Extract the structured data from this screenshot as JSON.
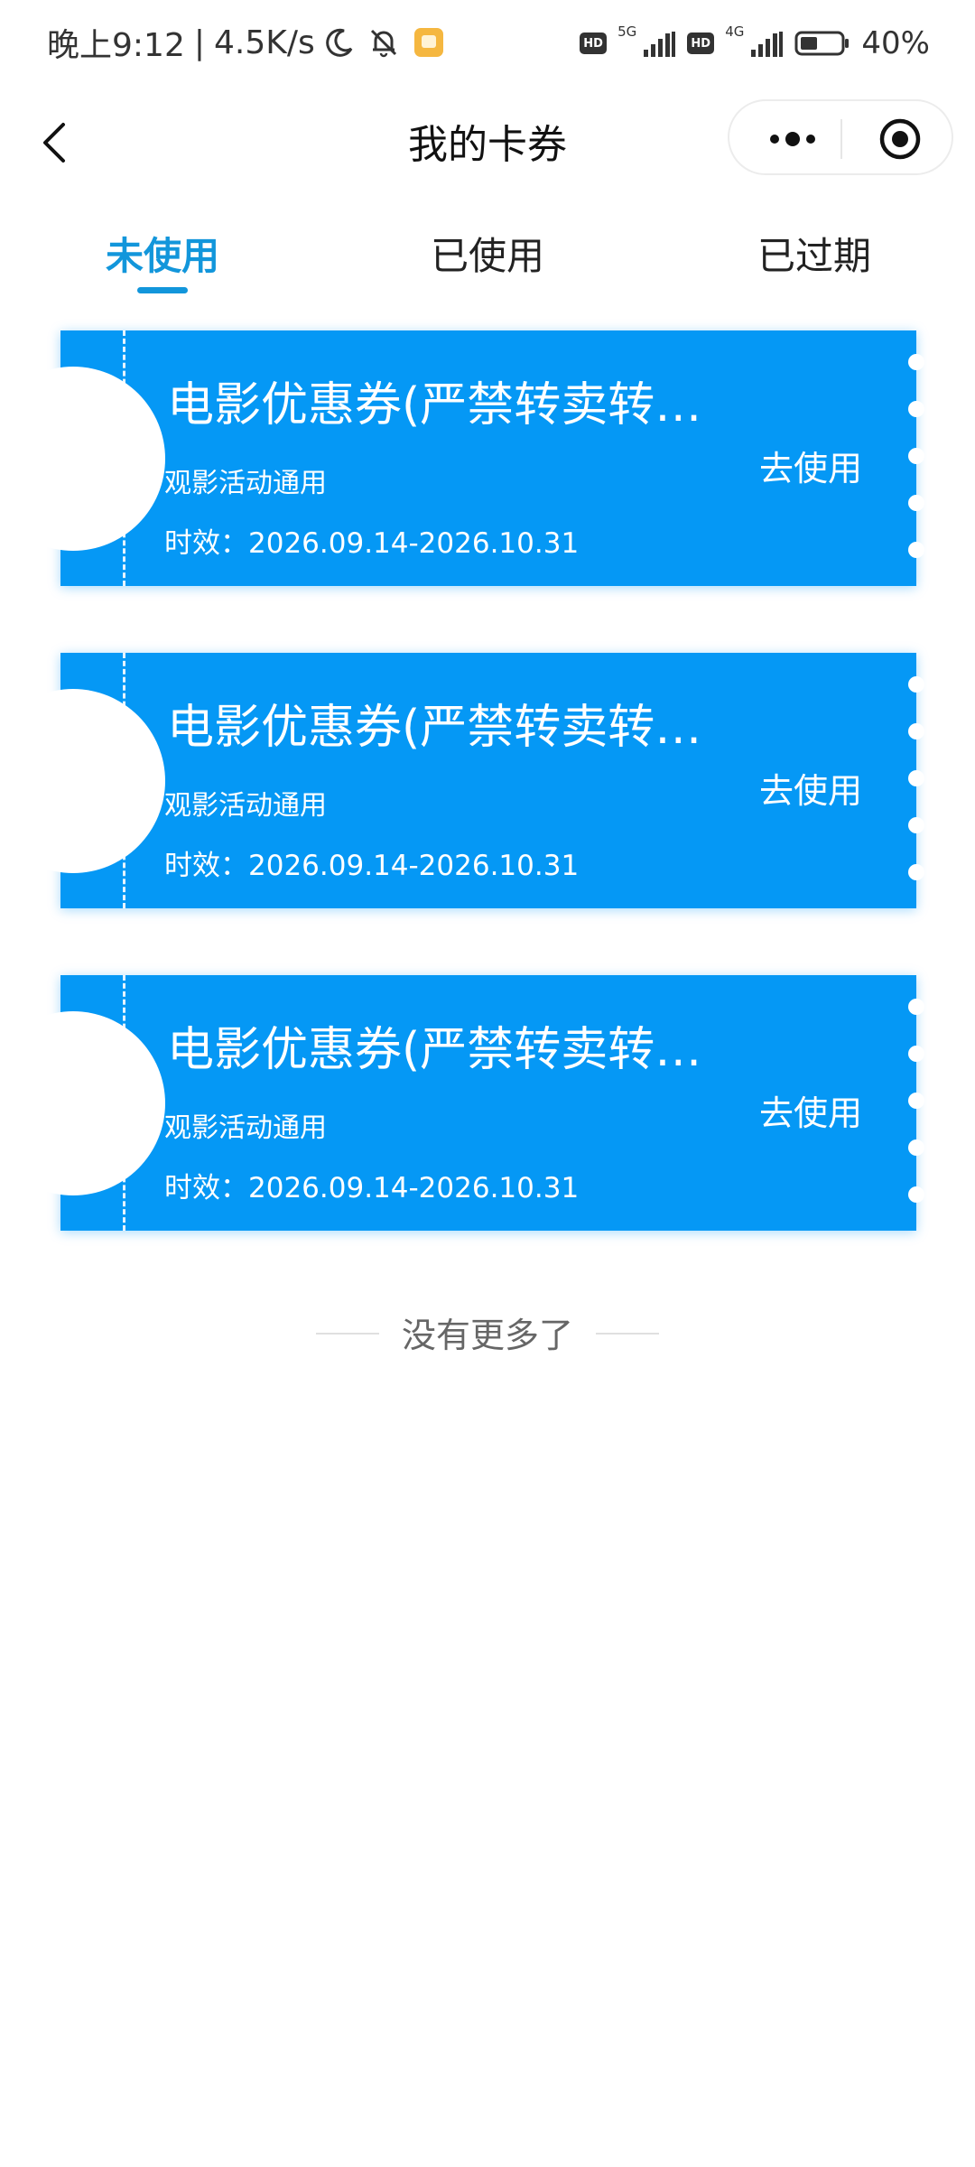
{
  "status_bar": {
    "time": "晚上9:12",
    "separator": "|",
    "speed": "4.5K/s",
    "hd1": "HD",
    "net1": "5G",
    "hd2": "HD",
    "net2": "4G",
    "battery": "40%"
  },
  "nav": {
    "title": "我的卡券"
  },
  "tabs": [
    {
      "label": "未使用",
      "active": true
    },
    {
      "label": "已使用",
      "active": false
    },
    {
      "label": "已过期",
      "active": false
    }
  ],
  "coupons": [
    {
      "title": "电影优惠券(严禁转卖转…",
      "desc": "观影活动通用",
      "validity": "时效：2026.09.14-2026.10.31",
      "action": "去使用"
    },
    {
      "title": "电影优惠券(严禁转卖转…",
      "desc": "观影活动通用",
      "validity": "时效：2026.09.14-2026.10.31",
      "action": "去使用"
    },
    {
      "title": "电影优惠券(严禁转卖转…",
      "desc": "观影活动通用",
      "validity": "时效：2026.09.14-2026.10.31",
      "action": "去使用"
    }
  ],
  "footer": {
    "end_text": "没有更多了"
  },
  "colors": {
    "accent": "#1296db",
    "coupon_bg": "#0598f5"
  },
  "icons": {
    "back": "chevron-left-icon",
    "more": "more-dots-icon",
    "close": "target-icon",
    "moon": "moon-icon",
    "bell": "bell-off-icon"
  }
}
